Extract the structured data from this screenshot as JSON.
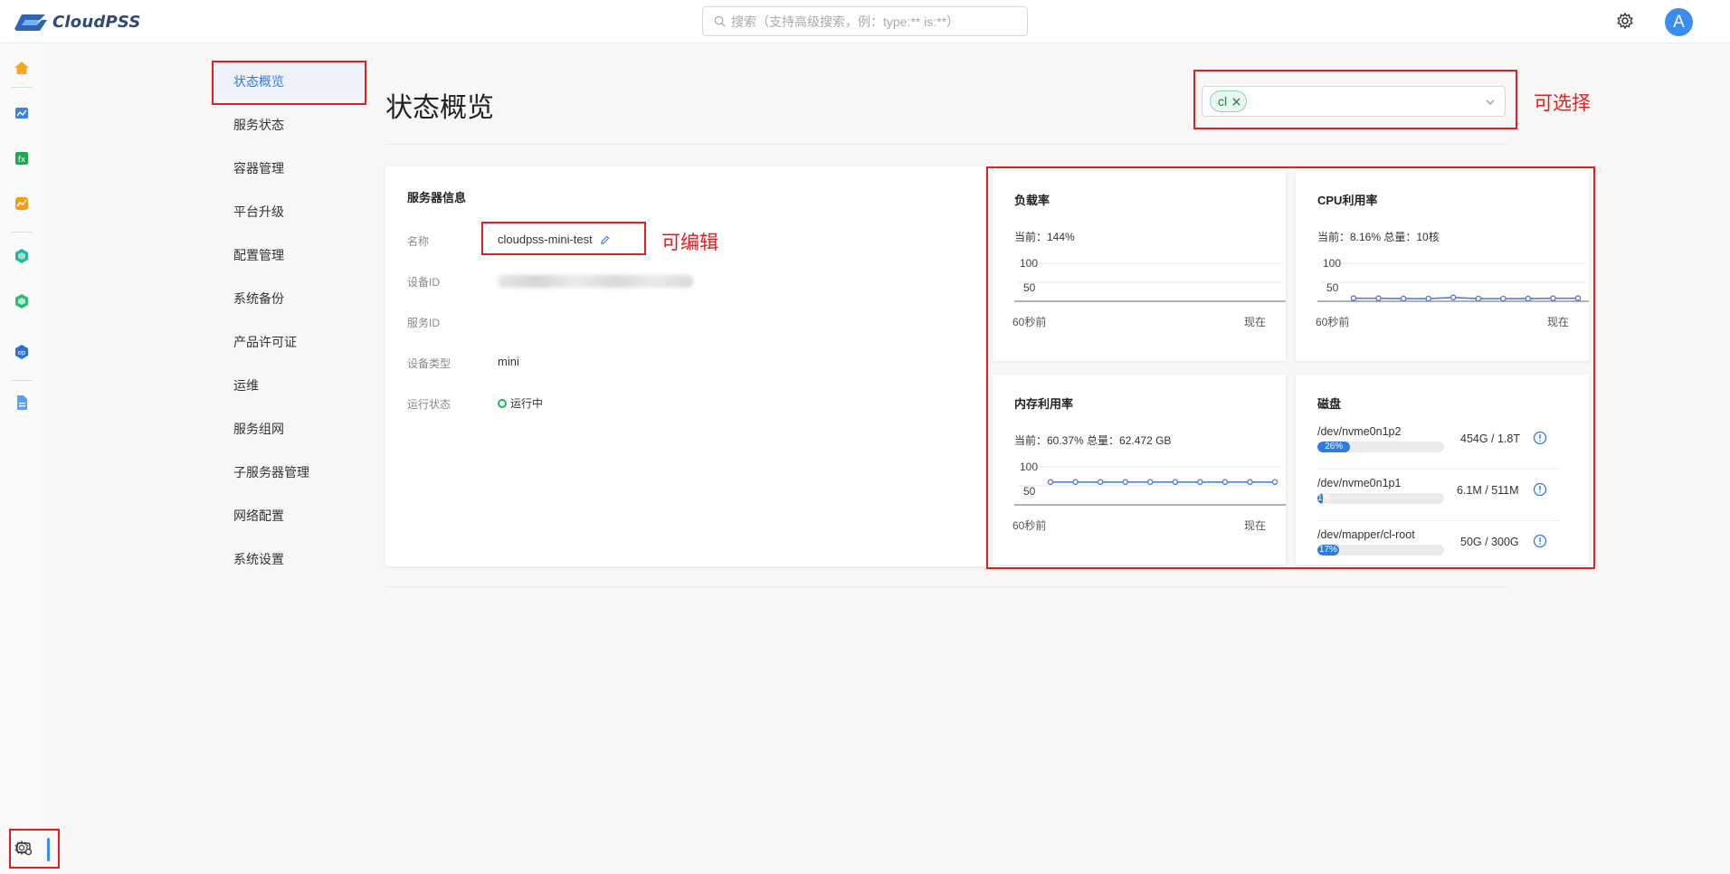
{
  "app": {
    "logo_text": "CloudPSS"
  },
  "search": {
    "placeholder": "搜索（支持高级搜索，例：type:** is:**）"
  },
  "user": {
    "avatar_letter": "A"
  },
  "sidebar": {
    "items": [
      {
        "label": "状态概览",
        "active": true
      },
      {
        "label": "服务状态"
      },
      {
        "label": "容器管理"
      },
      {
        "label": "平台升级"
      },
      {
        "label": "配置管理"
      },
      {
        "label": "系统备份"
      },
      {
        "label": "产品许可证"
      },
      {
        "label": "运维"
      },
      {
        "label": "服务组网"
      },
      {
        "label": "子服务器管理"
      },
      {
        "label": "网络配置"
      },
      {
        "label": "系统设置"
      }
    ]
  },
  "page": {
    "title": "状态概览"
  },
  "selector": {
    "tag": "cl"
  },
  "annotations": {
    "selectable": "可选择",
    "editable": "可编辑"
  },
  "server_info": {
    "title": "服务器信息",
    "name_label": "名称",
    "name_value": "cloudpss-mini-test",
    "device_id_label": "设备ID",
    "service_id_label": "服务ID",
    "device_type_label": "设备类型",
    "device_type_value": "mini",
    "run_status_label": "运行状态",
    "run_status_value": "运行中"
  },
  "metrics": {
    "load": {
      "title": "负载率",
      "current": "当前：144%"
    },
    "cpu": {
      "title": "CPU利用率",
      "current": "当前：8.16% 总量：10核"
    },
    "memory": {
      "title": "内存利用率",
      "current": "当前：60.37% 总量：62.472 GB"
    },
    "axis": {
      "y_high": "100",
      "y_mid": "50",
      "x_start": "60秒前",
      "x_end": "现在"
    },
    "disk": {
      "title": "磁盘",
      "items": [
        {
          "name": "/dev/nvme0n1p2",
          "size": "454G / 1.8T",
          "percent_label": "26%",
          "fraction": 0.26
        },
        {
          "name": "/dev/nvme0n1p1",
          "size": "6.1M / 511M",
          "percent_label": "1%",
          "fraction": 0.02
        },
        {
          "name": "/dev/mapper/cl-root",
          "size": "50G / 300G",
          "percent_label": "17%",
          "fraction": 0.17
        }
      ]
    }
  },
  "chart_data": [
    {
      "type": "line",
      "title": "负载率",
      "ylim": [
        0,
        100
      ],
      "values": []
    },
    {
      "type": "line",
      "title": "CPU利用率",
      "ylim": [
        0,
        100
      ],
      "values": [
        8,
        8,
        7,
        7,
        10,
        7,
        7,
        7,
        8,
        8
      ]
    },
    {
      "type": "line",
      "title": "内存利用率",
      "ylim": [
        0,
        100
      ],
      "values": [
        60,
        60,
        60,
        60,
        60,
        60,
        60,
        60,
        60,
        60
      ]
    }
  ],
  "colors": {
    "accent": "#2f7be0",
    "highlight": "#e02020",
    "status_ok": "#1bb35c"
  }
}
